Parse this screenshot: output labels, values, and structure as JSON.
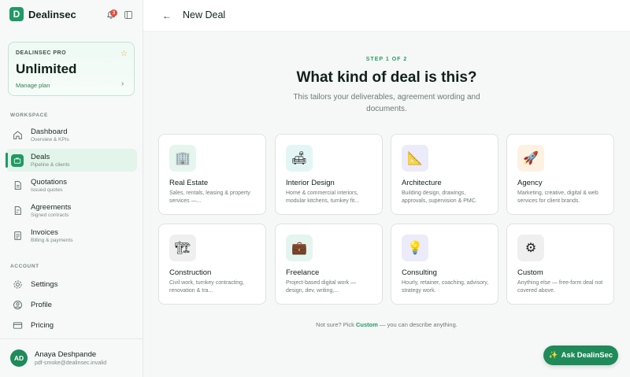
{
  "brand": {
    "name": "Dealinsec",
    "logo_letter": "D"
  },
  "notifications": {
    "count": "3"
  },
  "plan": {
    "label": "DEALINSEC PRO",
    "title": "Unlimited",
    "manage": "Manage plan"
  },
  "sidebar": {
    "workspace_label": "WORKSPACE",
    "workspace_items": [
      {
        "title": "Dashboard",
        "sub": "Overview & KPIs",
        "icon": "home-icon"
      },
      {
        "title": "Deals",
        "sub": "Pipeline & clients",
        "icon": "briefcase-icon",
        "active": true
      },
      {
        "title": "Quotations",
        "sub": "Issued quotes",
        "icon": "document-icon"
      },
      {
        "title": "Agreements",
        "sub": "Signed contracts",
        "icon": "contract-icon"
      },
      {
        "title": "Invoices",
        "sub": "Billing & payments",
        "icon": "invoice-icon"
      }
    ],
    "account_label": "ACCOUNT",
    "account_items": [
      {
        "title": "Settings",
        "icon": "gear-icon"
      },
      {
        "title": "Profile",
        "icon": "user-icon"
      },
      {
        "title": "Pricing",
        "icon": "card-icon"
      }
    ]
  },
  "user": {
    "initials": "AD",
    "name": "Anaya Deshpande",
    "email": "pdf-smoke@dealinsec.invalid"
  },
  "topbar": {
    "back": "←",
    "title": "New Deal"
  },
  "wizard": {
    "step": "STEP 1 OF 2",
    "heading": "What kind of deal is this?",
    "subtext": "This tailors your deliverables, agreement wording and documents."
  },
  "deal_types": [
    {
      "title": "Real Estate",
      "desc": "Sales, rentals, leasing & property services —...",
      "icon": "building-icon",
      "glyph": "🏢",
      "bg": "#e6f6ee"
    },
    {
      "title": "Interior Design",
      "desc": "Home & commercial interiors, modular kitchens, turnkey fit...",
      "icon": "sofa-icon",
      "glyph": "🛋",
      "bg": "#e4f5f5"
    },
    {
      "title": "Architecture",
      "desc": "Building design, drawings, approvals, supervision & PMC.",
      "icon": "triangle-ruler-icon",
      "glyph": "📐",
      "bg": "#ecebf9"
    },
    {
      "title": "Agency",
      "desc": "Marketing, creative, digital & web services for client brands.",
      "icon": "rocket-icon",
      "glyph": "🚀",
      "bg": "#fdf1e1"
    },
    {
      "title": "Construction",
      "desc": "Civil work, turnkey contracting, renovation & tra...",
      "icon": "crane-icon",
      "glyph": "🏗",
      "bg": "#efefef"
    },
    {
      "title": "Freelance",
      "desc": "Project-based digital work — design, dev, writing,...",
      "icon": "briefcase-icon",
      "glyph": "💼",
      "bg": "#e4f5ef"
    },
    {
      "title": "Consulting",
      "desc": "Hourly, retainer, coaching, advisory, strategy work.",
      "icon": "lightbulb-icon",
      "glyph": "💡",
      "bg": "#ecebf9"
    },
    {
      "title": "Custom",
      "desc": "Anything else — free-form deal not covered above.",
      "icon": "gear-icon",
      "glyph": "⚙",
      "bg": "#efefef"
    }
  ],
  "footer": {
    "before": "Not sure? Pick ",
    "link": "Custom",
    "after": " — you can describe anything."
  },
  "assistant": {
    "label": "Ask DealinSec",
    "glyph": "✨"
  }
}
